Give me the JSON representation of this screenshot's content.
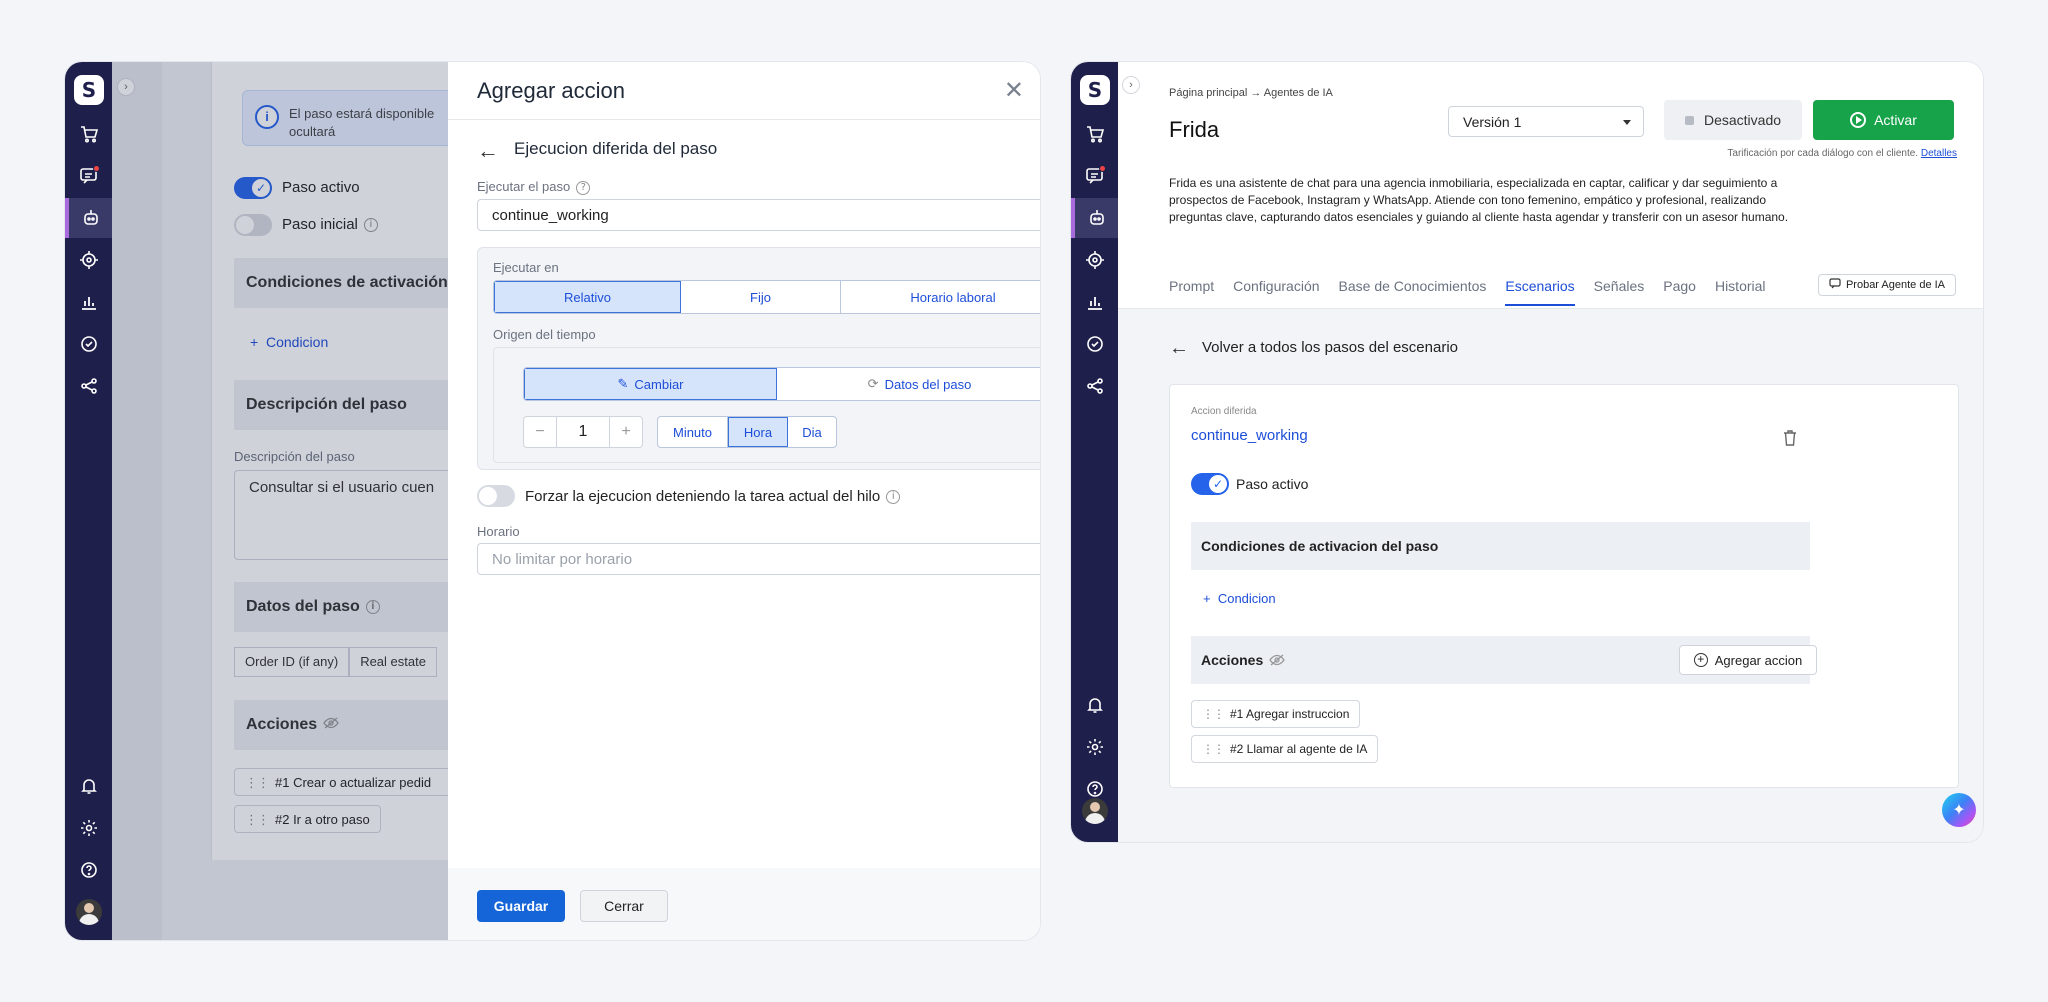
{
  "left_bg": {
    "info_text": [
      "El paso estará disponible",
      "ocultará"
    ],
    "paso_activo": "Paso activo",
    "paso_inicial": "Paso inicial",
    "condiciones": "Condiciones de activación c",
    "condicion_link": "Condicion",
    "descripcion_section": "Descripción del paso",
    "descripcion_label": "Descripción del paso",
    "descripcion_value": "Consultar si el usuario cuen",
    "datos_section": "Datos del paso",
    "datos_cells": [
      "Order ID (if any)",
      "Real estate"
    ],
    "acciones": "Acciones",
    "action_chips": [
      "#1 Crear o actualizar pedid",
      "#2 Ir a otro paso"
    ]
  },
  "modal": {
    "title": "Agregar accion",
    "close": "✕",
    "back": "←",
    "subtitle": "Ejecucion diferida del paso",
    "ejecutar_paso_label": "Ejecutar el paso",
    "ejecutar_paso_value": "continue_working",
    "ejecutar_en_label": "Ejecutar en",
    "ejecutar_en_options": [
      "Relativo",
      "Fijo",
      "Horario laboral"
    ],
    "origen_label": "Origen del tiempo",
    "origen_options": [
      "Cambiar",
      "Datos del paso"
    ],
    "stepper_value": "1",
    "stepper_minus": "−",
    "stepper_plus": "+",
    "unit_options": [
      "Minuto",
      "Hora",
      "Dia"
    ],
    "forzar_label": "Forzar la ejecucion deteniendo la tarea actual del hilo",
    "horario_label": "Horario",
    "horario_placeholder": "No limitar por horario",
    "guardar": "Guardar",
    "cerrar": "Cerrar"
  },
  "right": {
    "breadcrumb": "Página principal → Agentes de IA",
    "title": "Frida",
    "version": "Versión 1",
    "desactivado": "Desactivado",
    "activar": "Activar",
    "tarificacion": "Tarificación por cada diálogo con el cliente.",
    "detalles": "Detalles",
    "description": "Frida es una asistente de chat para una agencia inmobiliaria, especializada en captar, calificar y dar seguimiento a prospectos de Facebook, Instagram y WhatsApp. Atiende con tono femenino, empático y profesional, realizando preguntas clave, capturando datos esenciales y guiando al cliente hasta agendar y transferir con un asesor humano.",
    "tabs": [
      "Prompt",
      "Configuración",
      "Base de Conocimientos",
      "Escenarios",
      "Señales",
      "Pago",
      "Historial"
    ],
    "active_tab": "Escenarios",
    "probar": "Probar Agente de IA",
    "back_text": "Volver a todos los pasos del escenario",
    "accion_small": "Accion diferida",
    "accion_name": "continue_working",
    "paso_activo": "Paso activo",
    "condiciones": "Condiciones de activacion del paso",
    "condicion_link": "Condicion",
    "acciones": "Acciones",
    "agregar_accion": "Agregar accion",
    "action_chips": [
      "#1 Agregar instruccion",
      "#2 Llamar al agente de IA"
    ]
  },
  "colors": {
    "rail": "#1f1f4b",
    "primary": "#1565d8",
    "success": "#16a34a",
    "link": "#1d4ed8"
  },
  "icons": [
    "logo-icon",
    "cart-icon",
    "chat-icon",
    "robot-icon",
    "target-icon",
    "chart-icon",
    "check-circle-icon",
    "share-icon",
    "bell-icon",
    "gear-icon",
    "help-icon"
  ]
}
